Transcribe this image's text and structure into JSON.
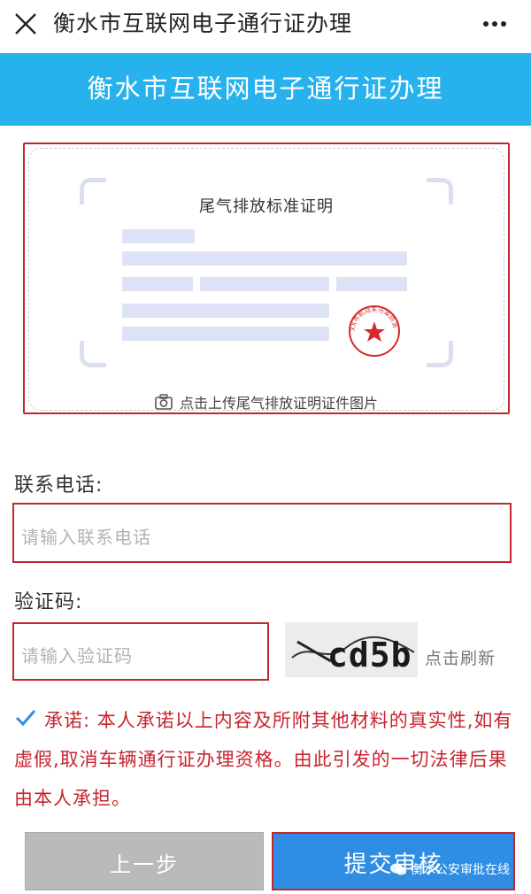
{
  "topbar": {
    "title": "衡水市互联网电子通行证办理",
    "close_icon": "close-icon",
    "more_icon": "more-dots-icon"
  },
  "banner": {
    "title": "衡水市互联网电子通行证办理",
    "color": "#27b2ee"
  },
  "upload": {
    "doc_title": "尾气排放标准证明",
    "hint": "点击上传尾气排放证明证件图片",
    "camera_icon": "camera-icon",
    "stamp_text": "XX市机动车污染防治中心"
  },
  "form": {
    "phone": {
      "label": "联系电话:",
      "placeholder": "请输入联系电话",
      "value": ""
    },
    "code": {
      "label": "验证码:",
      "placeholder": "请输入验证码",
      "value": ""
    },
    "captcha_text": "cd5b",
    "refresh_label": "点击刷新"
  },
  "promise": {
    "checked": true,
    "text": "承诺: 本人承诺以上内容及所附其他材料的真实性,如有虚假,取消车辆通行证办理资格。由此引发的一切法律后果由本人承担。"
  },
  "buttons": {
    "prev_label": "上一步",
    "submit_label": "提交审核"
  },
  "watermark": {
    "text": "衡水公安审批在线"
  },
  "colors": {
    "accent_blue": "#27b2ee",
    "submit_blue": "#2f8ee3",
    "highlight_red": "#c0282e",
    "promise_red": "#c8242d"
  }
}
